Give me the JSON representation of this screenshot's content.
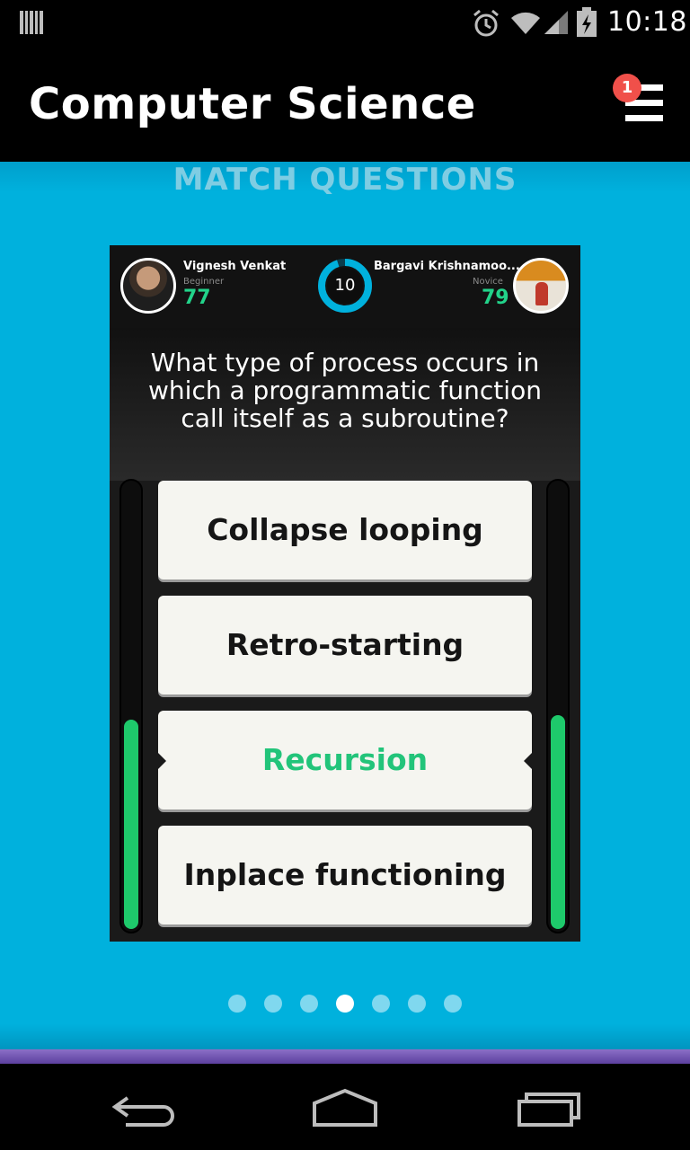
{
  "status_bar": {
    "time": "10:18",
    "icons": [
      "notification-icon",
      "alarm-icon",
      "wifi-icon",
      "signal-icon",
      "battery-icon"
    ]
  },
  "app_bar": {
    "title": "Computer Science",
    "menu_badge_count": "1",
    "menu_icon": "menu-icon"
  },
  "section_title": "MATCH QUESTIONS",
  "match": {
    "player1": {
      "name": "Vignesh Venkat",
      "level": "Beginner",
      "score": "77",
      "timer_fill": 0.47
    },
    "player2": {
      "name": "Bargavi Krishnamoo...",
      "level": "Novice",
      "score": "79",
      "timer_fill": 0.48
    },
    "timer": "10",
    "timer_fraction": 0.95,
    "question": "What type of process occurs in which a programmatic function call itself as a subroutine?",
    "options": [
      {
        "label": "Collapse looping",
        "state": "normal"
      },
      {
        "label": "Retro-starting",
        "state": "normal"
      },
      {
        "label": "Recursion",
        "state": "correct"
      },
      {
        "label": "Inplace functioning",
        "state": "normal"
      }
    ]
  },
  "pager": {
    "count": 7,
    "active_index": 3
  },
  "colors": {
    "background": "#00b1dd",
    "accent_green": "#22c47a",
    "badge": "#f0504a",
    "timer_ring": "#00b1dd"
  },
  "navigation": [
    "back-icon",
    "home-icon",
    "recent-apps-icon"
  ]
}
